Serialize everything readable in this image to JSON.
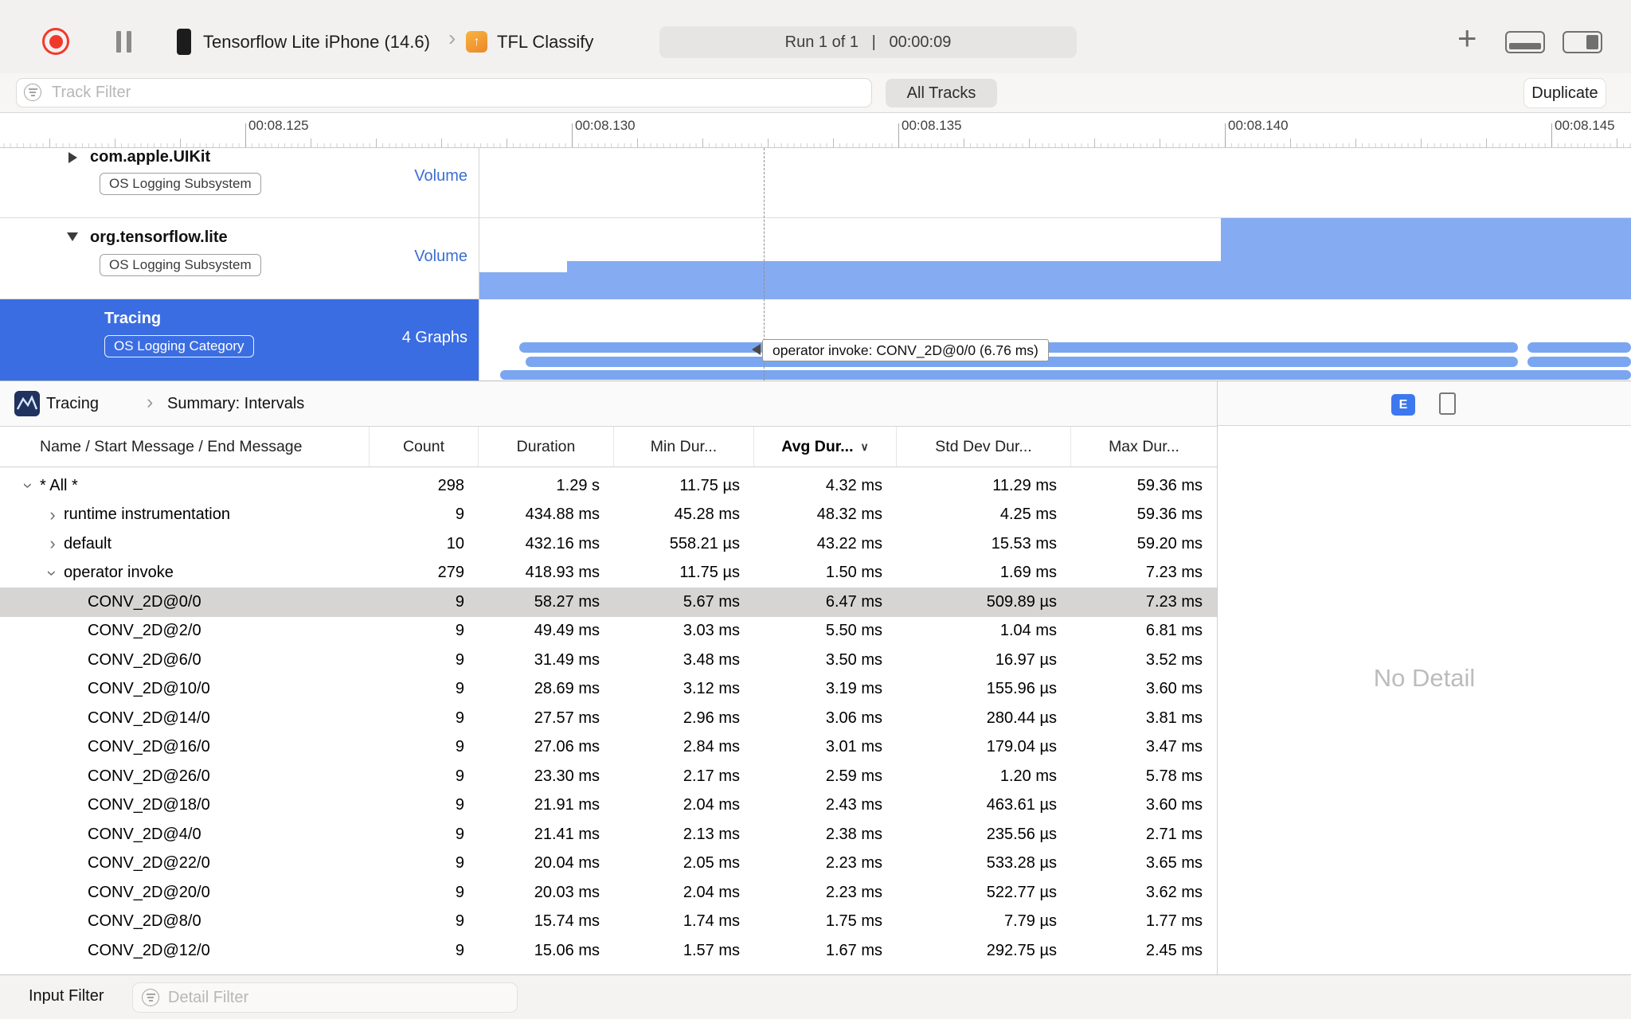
{
  "toolbar": {
    "device_name": "Tensorflow Lite iPhone (14.6)",
    "target_name": "TFL Classify",
    "run_status": "Run 1 of 1   |   00:00:09"
  },
  "filter_bar": {
    "track_filter_placeholder": "Track Filter",
    "all_tracks": "All Tracks",
    "duplicate": "Duplicate"
  },
  "timeline": {
    "ruler_labels": [
      "00:08.125",
      "00:08.130",
      "00:08.135",
      "00:08.140",
      "00:08.145"
    ],
    "tooltip": "operator invoke: CONV_2D@0/0 (6.76 ms)",
    "tracks": [
      {
        "name": "com.apple.UIKit",
        "badge": "OS Logging Subsystem",
        "meta": "Volume"
      },
      {
        "name": "org.tensorflow.lite",
        "badge": "OS Logging Subsystem",
        "meta": "Volume"
      },
      {
        "name": "Tracing",
        "badge": "OS Logging Category",
        "meta": "4 Graphs"
      }
    ]
  },
  "detail": {
    "breadcrumb_root": "Tracing",
    "breadcrumb_chevron": "›",
    "breadcrumb_page": "Summary: Intervals",
    "view_mode_label": "E",
    "no_detail": "No Detail",
    "columns": [
      "Name / Start Message / End Message",
      "Count",
      "Duration",
      "Min Dur...",
      "Avg Dur...",
      "Std Dev Dur...",
      "Max Dur..."
    ],
    "sorted_column": "Avg Dur...",
    "rows": [
      {
        "name": "* All *",
        "count": "298",
        "duration": "1.29 s",
        "min": "11.75 µs",
        "avg": "4.32 ms",
        "std": "11.29 ms",
        "max": "59.36 ms",
        "level": 0,
        "disclosure": "expanded",
        "selected": false
      },
      {
        "name": "runtime instrumentation",
        "count": "9",
        "duration": "434.88 ms",
        "min": "45.28 ms",
        "avg": "48.32 ms",
        "std": "4.25 ms",
        "max": "59.36 ms",
        "level": 1,
        "disclosure": "collapsed",
        "selected": false
      },
      {
        "name": "default",
        "count": "10",
        "duration": "432.16 ms",
        "min": "558.21 µs",
        "avg": "43.22 ms",
        "std": "15.53 ms",
        "max": "59.20 ms",
        "level": 1,
        "disclosure": "collapsed",
        "selected": false
      },
      {
        "name": "operator invoke",
        "count": "279",
        "duration": "418.93 ms",
        "min": "11.75 µs",
        "avg": "1.50 ms",
        "std": "1.69 ms",
        "max": "7.23 ms",
        "level": 1,
        "disclosure": "expanded",
        "selected": false
      },
      {
        "name": "CONV_2D@0/0",
        "count": "9",
        "duration": "58.27 ms",
        "min": "5.67 ms",
        "avg": "6.47 ms",
        "std": "509.89 µs",
        "max": "7.23 ms",
        "level": 2,
        "disclosure": null,
        "selected": true
      },
      {
        "name": "CONV_2D@2/0",
        "count": "9",
        "duration": "49.49 ms",
        "min": "3.03 ms",
        "avg": "5.50 ms",
        "std": "1.04 ms",
        "max": "6.81 ms",
        "level": 2,
        "disclosure": null,
        "selected": false
      },
      {
        "name": "CONV_2D@6/0",
        "count": "9",
        "duration": "31.49 ms",
        "min": "3.48 ms",
        "avg": "3.50 ms",
        "std": "16.97 µs",
        "max": "3.52 ms",
        "level": 2,
        "disclosure": null,
        "selected": false
      },
      {
        "name": "CONV_2D@10/0",
        "count": "9",
        "duration": "28.69 ms",
        "min": "3.12 ms",
        "avg": "3.19 ms",
        "std": "155.96 µs",
        "max": "3.60 ms",
        "level": 2,
        "disclosure": null,
        "selected": false
      },
      {
        "name": "CONV_2D@14/0",
        "count": "9",
        "duration": "27.57 ms",
        "min": "2.96 ms",
        "avg": "3.06 ms",
        "std": "280.44 µs",
        "max": "3.81 ms",
        "level": 2,
        "disclosure": null,
        "selected": false
      },
      {
        "name": "CONV_2D@16/0",
        "count": "9",
        "duration": "27.06 ms",
        "min": "2.84 ms",
        "avg": "3.01 ms",
        "std": "179.04 µs",
        "max": "3.47 ms",
        "level": 2,
        "disclosure": null,
        "selected": false
      },
      {
        "name": "CONV_2D@26/0",
        "count": "9",
        "duration": "23.30 ms",
        "min": "2.17 ms",
        "avg": "2.59 ms",
        "std": "1.20 ms",
        "max": "5.78 ms",
        "level": 2,
        "disclosure": null,
        "selected": false
      },
      {
        "name": "CONV_2D@18/0",
        "count": "9",
        "duration": "21.91 ms",
        "min": "2.04 ms",
        "avg": "2.43 ms",
        "std": "463.61 µs",
        "max": "3.60 ms",
        "level": 2,
        "disclosure": null,
        "selected": false
      },
      {
        "name": "CONV_2D@4/0",
        "count": "9",
        "duration": "21.41 ms",
        "min": "2.13 ms",
        "avg": "2.38 ms",
        "std": "235.56 µs",
        "max": "2.71 ms",
        "level": 2,
        "disclosure": null,
        "selected": false
      },
      {
        "name": "CONV_2D@22/0",
        "count": "9",
        "duration": "20.04 ms",
        "min": "2.05 ms",
        "avg": "2.23 ms",
        "std": "533.28 µs",
        "max": "3.65 ms",
        "level": 2,
        "disclosure": null,
        "selected": false
      },
      {
        "name": "CONV_2D@20/0",
        "count": "9",
        "duration": "20.03 ms",
        "min": "2.04 ms",
        "avg": "2.23 ms",
        "std": "522.77 µs",
        "max": "3.62 ms",
        "level": 2,
        "disclosure": null,
        "selected": false
      },
      {
        "name": "CONV_2D@8/0",
        "count": "9",
        "duration": "15.74 ms",
        "min": "1.74 ms",
        "avg": "1.75 ms",
        "std": "7.79 µs",
        "max": "1.77 ms",
        "level": 2,
        "disclosure": null,
        "selected": false
      },
      {
        "name": "CONV_2D@12/0",
        "count": "9",
        "duration": "15.06 ms",
        "min": "1.57 ms",
        "avg": "1.67 ms",
        "std": "292.75 µs",
        "max": "2.45 ms",
        "level": 2,
        "disclosure": null,
        "selected": false
      }
    ]
  },
  "bottom_bar": {
    "label": "Input Filter",
    "detail_filter_placeholder": "Detail Filter"
  }
}
